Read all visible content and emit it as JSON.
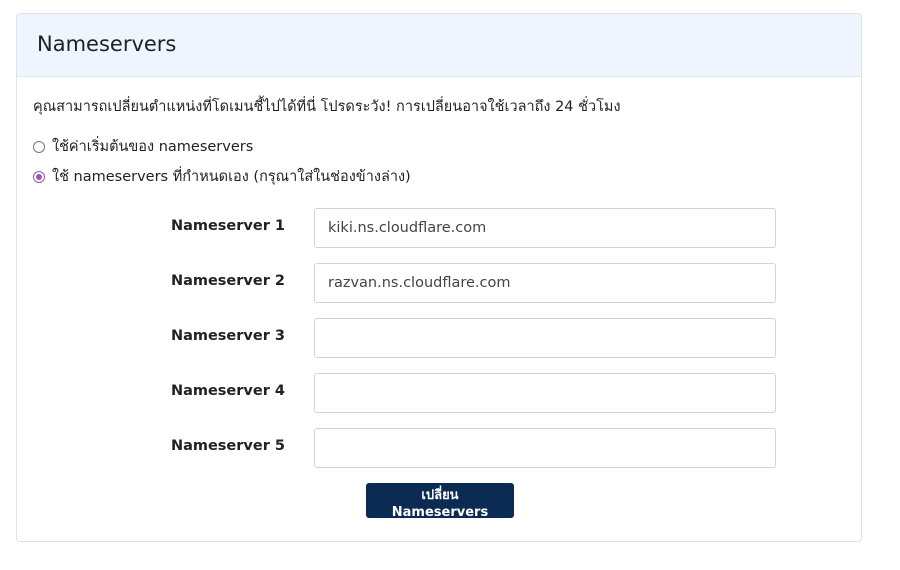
{
  "card": {
    "title": "Nameservers",
    "description": "คุณสามารถเปลี่ยนตำแหน่งที่โดเมนชี้ไปได้ที่นี่ โปรดระวัง! การเปลี่ยนอาจใช้เวลาถึง 24 ชั่วโมง"
  },
  "options": [
    {
      "label": "ใช้ค่าเริ่มต้นของ nameservers",
      "checked": false
    },
    {
      "label": "ใช้ nameservers ที่กำหนดเอง (กรุณาใส่ในช่องข้างล่าง)",
      "checked": true
    }
  ],
  "nameservers": [
    {
      "label": "Nameserver 1",
      "value": "kiki.ns.cloudflare.com"
    },
    {
      "label": "Nameserver 2",
      "value": "razvan.ns.cloudflare.com"
    },
    {
      "label": "Nameserver 3",
      "value": ""
    },
    {
      "label": "Nameserver 4",
      "value": ""
    },
    {
      "label": "Nameserver 5",
      "value": ""
    }
  ],
  "submit_label": "เปลี่ยน Nameservers",
  "colors": {
    "header_bg": "#eef5fe",
    "radio_accent": "#9b59b6",
    "button_bg": "#0b2b53"
  }
}
